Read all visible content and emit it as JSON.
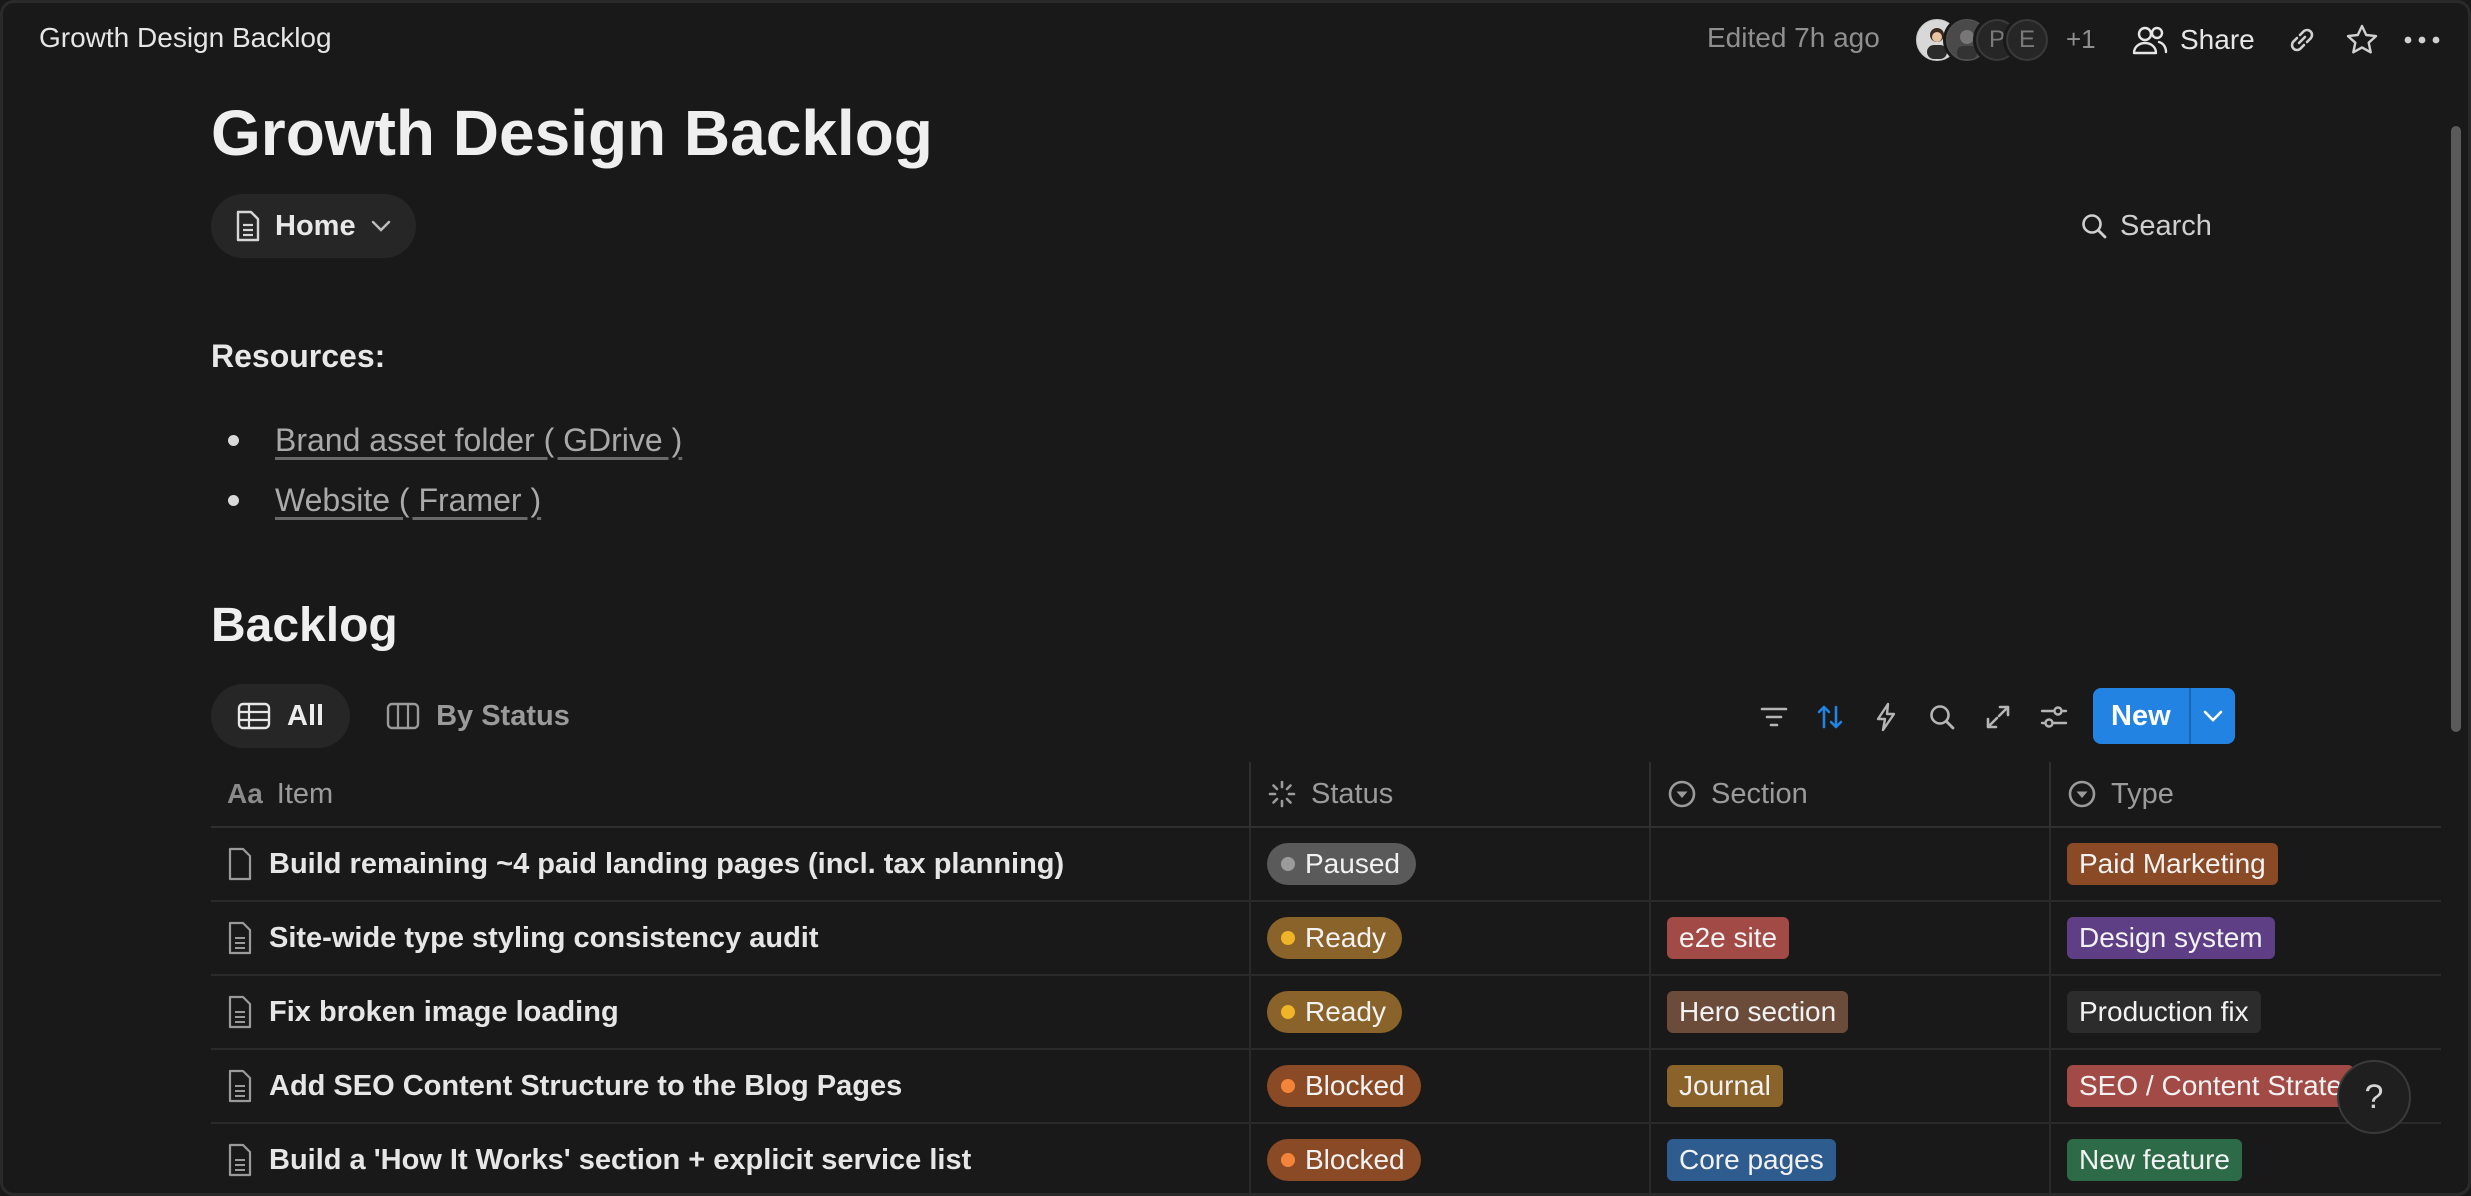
{
  "topbar": {
    "breadcrumb": "Growth Design Backlog",
    "edited": "Edited 7h ago",
    "avatars": [
      "",
      "",
      "P",
      "E"
    ],
    "extra_count": "+1",
    "share_label": "Share",
    "icons": [
      "people-icon",
      "link-icon",
      "star-icon",
      "more-icon"
    ]
  },
  "page": {
    "title": "Growth Design Backlog",
    "home_label": "Home",
    "search_label": "Search",
    "resources_label": "Resources:",
    "links": [
      "Brand asset folder ( GDrive )",
      "Website ( Framer )"
    ],
    "backlog_heading": "Backlog"
  },
  "views": {
    "tabs": [
      {
        "label": "All",
        "active": true
      },
      {
        "label": "By Status",
        "active": false
      }
    ],
    "new_label": "New"
  },
  "table": {
    "headers": {
      "item": "Item",
      "item_icon": "Aa",
      "status": "Status",
      "section": "Section",
      "type": "Type"
    },
    "rows": [
      {
        "item": "Build remaining ~4 paid landing pages (incl. tax planning)",
        "status": "Paused",
        "section": "",
        "type": "Paid Marketing"
      },
      {
        "item": "Site-wide type styling consistency audit",
        "status": "Ready",
        "section": "e2e site",
        "type": "Design system"
      },
      {
        "item": "Fix broken image loading",
        "status": "Ready",
        "section": "Hero section",
        "type": "Production fix"
      },
      {
        "item": "Add SEO Content Structure to the Blog Pages",
        "status": "Blocked",
        "section": "Journal",
        "type": "SEO / Content Strate"
      },
      {
        "item": "Build a 'How It Works' section + explicit service list",
        "status": "Blocked",
        "section": "Core pages",
        "type": "New feature"
      }
    ]
  },
  "colors": {
    "background": "#191919",
    "accent": "#2383e2",
    "status_paused": "#5a5a5a",
    "status_paused_dot": "#9b9b9b",
    "status_ready": "#89632a",
    "status_ready_dot": "#f0b429",
    "status_blocked": "#8a4a25",
    "status_blocked_dot": "#f2853a",
    "section_e2e": "#a24a45",
    "section_hero": "#6b4c3b",
    "section_journal": "#89632a",
    "section_core": "#2f5c8f",
    "type_paid": "#8a4a25",
    "type_design": "#5e3f86",
    "type_prod": "#2c2c2c",
    "type_seo": "#a24a45",
    "type_new": "#2d6b48"
  },
  "help_label": "?"
}
